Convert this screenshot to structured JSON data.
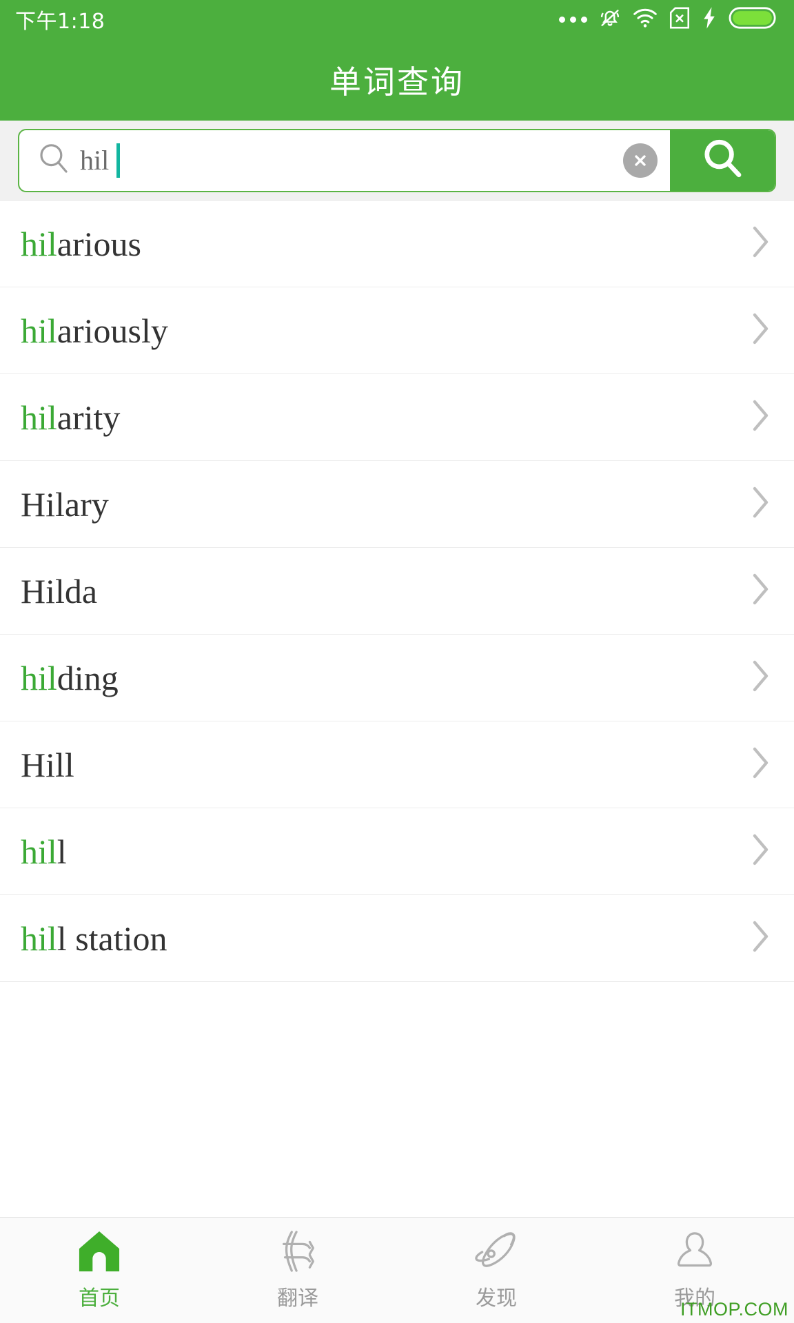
{
  "statusbar": {
    "time": "下午1:18",
    "icons": [
      "more-dots-icon",
      "bell-muted-icon",
      "wifi-icon",
      "sim-card-off-icon",
      "charging-bolt-icon",
      "battery-icon"
    ]
  },
  "header": {
    "title": "单词查询"
  },
  "search": {
    "value": "hil",
    "placeholder": "",
    "search_icon": "search-icon",
    "clear_icon": "clear-circle-icon",
    "button_icon": "search-icon",
    "accent": "#4CAF3E",
    "caret_color": "#12B6A0"
  },
  "results": {
    "query_prefix": "hil",
    "highlight_color": "#3BA935",
    "chevron_icon": "chevron-right-icon",
    "items": [
      {
        "match": "hil",
        "rest": "arious",
        "word": "hilarious"
      },
      {
        "match": "hil",
        "rest": "ariously",
        "word": "hilariously"
      },
      {
        "match": "hil",
        "rest": "arity",
        "word": "hilarity"
      },
      {
        "match": "",
        "rest": "Hilary",
        "word": "Hilary"
      },
      {
        "match": "",
        "rest": "Hilda",
        "word": "Hilda"
      },
      {
        "match": "hil",
        "rest": "ding",
        "word": "hilding"
      },
      {
        "match": "",
        "rest": "Hill",
        "word": "Hill"
      },
      {
        "match": "hil",
        "rest": "l",
        "word": "hill"
      },
      {
        "match": "hil",
        "rest": "l station",
        "word": "hill station"
      }
    ]
  },
  "tabbar": {
    "items": [
      {
        "label": "首页",
        "icon": "home-icon",
        "active": true
      },
      {
        "label": "翻译",
        "icon": "translate-icon",
        "active": false
      },
      {
        "label": "发现",
        "icon": "rocket-icon",
        "active": false
      },
      {
        "label": "我的",
        "icon": "person-icon",
        "active": false
      }
    ]
  },
  "watermark": {
    "text": "ITMOP.COM"
  }
}
